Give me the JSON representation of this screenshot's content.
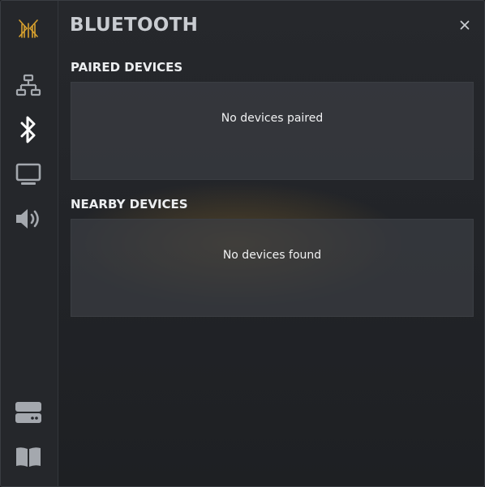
{
  "sidebar": {
    "items": [
      {
        "name": "logo",
        "icon": "logo-icon"
      },
      {
        "name": "network",
        "icon": "network-icon"
      },
      {
        "name": "bluetooth",
        "icon": "bluetooth-icon",
        "active": true
      },
      {
        "name": "display",
        "icon": "monitor-icon"
      },
      {
        "name": "audio",
        "icon": "speaker-icon"
      },
      {
        "name": "storage",
        "icon": "drive-icon"
      },
      {
        "name": "manual",
        "icon": "book-icon"
      }
    ]
  },
  "header": {
    "title": "BLUETOOTH",
    "close_label": "×"
  },
  "sections": {
    "paired": {
      "title": "PAIRED DEVICES",
      "empty_text": "No devices paired"
    },
    "nearby": {
      "title": "NEARBY DEVICES",
      "empty_text": "No devices found"
    }
  },
  "colors": {
    "accent": "#d8a12e",
    "icon_default": "#a4a8ae",
    "icon_active": "#ffffff",
    "text_primary": "#eceef0"
  }
}
